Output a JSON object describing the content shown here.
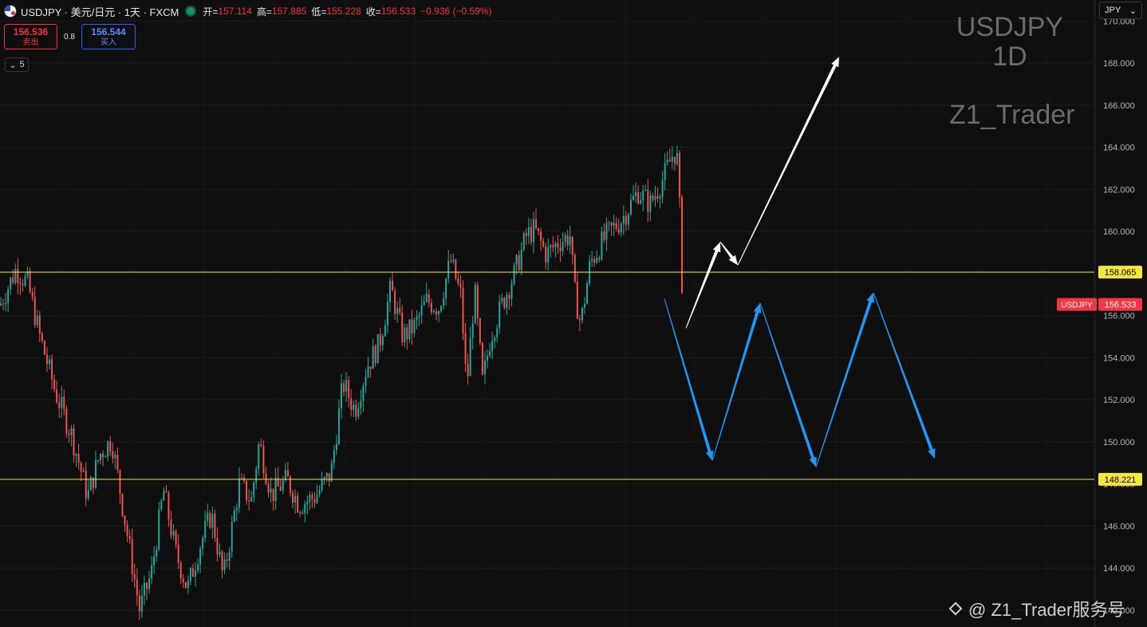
{
  "header": {
    "symbol_line": "USDJPY · 美元/日元 · 1天 · FXCM",
    "ohlc": [
      {
        "k": "开=",
        "v": "157.114"
      },
      {
        "k": "高=",
        "v": "157.885"
      },
      {
        "k": "低=",
        "v": "155.228"
      },
      {
        "k": "收=",
        "v": "156.533"
      }
    ],
    "change": "−0.936 (−0.59%)",
    "sell_price": "156.536",
    "sell_label": "卖出",
    "spread": "0.8",
    "buy_price": "156.544",
    "buy_label": "买入",
    "collapse_count": "5",
    "currency": "JPY"
  },
  "watermark": {
    "symbol": "USDJPY",
    "timeframe": "1D",
    "author": "Z1_Trader"
  },
  "footer": {
    "text": "@ Z1_Trader服务号"
  },
  "colors": {
    "background": "#0f0f0f",
    "up": "#26a69a",
    "down": "#ef5350",
    "level": "#f5e63c",
    "white_arrow": "#ffffff",
    "blue_arrow": "#2196f3",
    "last_price": "#f23645"
  },
  "chart_data": {
    "type": "candlestick",
    "ylim": [
      141.2,
      171.0
    ],
    "yticks": [
      142,
      144,
      146,
      148,
      150,
      152,
      154,
      156,
      158,
      160,
      162,
      164,
      166,
      168,
      170
    ],
    "ytick_labels": [
      "142.000",
      "144.000",
      "146.000",
      "148.000",
      "150.000",
      "152.000",
      "154.000",
      "156.000",
      "158.000",
      "160.000",
      "162.000",
      "164.000",
      "166.000",
      "168.000",
      "170.000"
    ],
    "levels": [
      {
        "value": 158.065,
        "label": "158.065"
      },
      {
        "value": 148.221,
        "label": "148.221"
      }
    ],
    "last_price": {
      "value": 156.533,
      "label": "156.533",
      "symbol": "USDJPY"
    },
    "price_path": [
      [
        0,
        156.5
      ],
      [
        20,
        158.2
      ],
      [
        35,
        157.5
      ],
      [
        50,
        155.0
      ],
      [
        70,
        152.3
      ],
      [
        90,
        150.3
      ],
      [
        110,
        147.4
      ],
      [
        125,
        149.4
      ],
      [
        140,
        150.1
      ],
      [
        160,
        145.5
      ],
      [
        175,
        142.0
      ],
      [
        190,
        143.8
      ],
      [
        205,
        147.7
      ],
      [
        220,
        144.8
      ],
      [
        235,
        143.0
      ],
      [
        250,
        145.0
      ],
      [
        265,
        146.6
      ],
      [
        280,
        143.5
      ],
      [
        300,
        148.0
      ],
      [
        315,
        147.2
      ],
      [
        325,
        150.0
      ],
      [
        340,
        147.5
      ],
      [
        360,
        148.2
      ],
      [
        375,
        147.0
      ],
      [
        395,
        147.4
      ],
      [
        415,
        148.5
      ],
      [
        430,
        152.8
      ],
      [
        445,
        151.5
      ],
      [
        460,
        153.6
      ],
      [
        475,
        154.6
      ],
      [
        490,
        157.3
      ],
      [
        505,
        155.0
      ],
      [
        520,
        155.5
      ],
      [
        535,
        156.7
      ],
      [
        550,
        156.4
      ],
      [
        565,
        158.6
      ],
      [
        578,
        156.9
      ],
      [
        585,
        152.5
      ],
      [
        595,
        157.2
      ],
      [
        605,
        152.8
      ],
      [
        615,
        155.0
      ],
      [
        630,
        156.6
      ],
      [
        645,
        158.0
      ],
      [
        660,
        159.8
      ],
      [
        670,
        160.1
      ],
      [
        685,
        158.9
      ],
      [
        700,
        159.5
      ],
      [
        715,
        159.8
      ],
      [
        720,
        157.2
      ],
      [
        728,
        155.6
      ],
      [
        740,
        158.5
      ],
      [
        760,
        159.8
      ],
      [
        780,
        160.6
      ],
      [
        800,
        161.9
      ],
      [
        815,
        161.3
      ],
      [
        830,
        162.4
      ],
      [
        845,
        163.8
      ],
      [
        850,
        163.3
      ],
      [
        855,
        157.6
      ],
      [
        860,
        156.5
      ]
    ],
    "arrows": [
      {
        "color": "white",
        "points": [
          [
            860,
            155.4
          ],
          [
            903,
            159.5
          ],
          [
            925,
            158.4
          ],
          [
            1052,
            168.3
          ]
        ]
      },
      {
        "color": "blue",
        "points": [
          [
            833,
            156.8
          ],
          [
            893,
            149.1
          ],
          [
            953,
            156.6
          ],
          [
            1023,
            148.8
          ],
          [
            1095,
            157.1
          ],
          [
            1172,
            149.2
          ]
        ]
      }
    ]
  }
}
